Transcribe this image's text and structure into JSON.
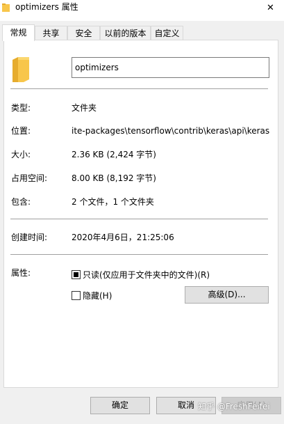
{
  "window": {
    "title": "optimizers 属性",
    "close_glyph": "✕",
    "close_icon": "close-icon",
    "folder_icon": "folder-icon",
    "folder_color": "#f8c64b"
  },
  "tabs": [
    {
      "label": "常规",
      "active": true
    },
    {
      "label": "共享",
      "active": false
    },
    {
      "label": "安全",
      "active": false
    },
    {
      "label": "以前的版本",
      "active": false
    },
    {
      "label": "自定义",
      "active": false
    }
  ],
  "general": {
    "name_value": "optimizers",
    "type_label": "类型:",
    "type_value": "文件夹",
    "location_label": "位置:",
    "location_value": "ite-packages\\tensorflow\\contrib\\keras\\api\\keras",
    "size_label": "大小:",
    "size_value": "2.36 KB (2,424 字节)",
    "disk_label": "占用空间:",
    "disk_value": "8.00 KB (8,192 字节)",
    "contains_label": "包含:",
    "contains_value": "2 个文件，1 个文件夹",
    "created_label": "创建时间:",
    "created_value": "2020年4月6日，21:25:06",
    "attributes_label": "属性:",
    "readonly_label": "只读(仅应用于文件夹中的文件)(R)",
    "readonly_state": "indeterminate",
    "hidden_label": "隐藏(H)",
    "hidden_checked": false,
    "advanced_label": "高级(D)..."
  },
  "footer": {
    "ok_label": "确定",
    "cancel_label": "取消",
    "apply_label": "应用(A)"
  },
  "watermark": "知乎 @FreshFeifei"
}
